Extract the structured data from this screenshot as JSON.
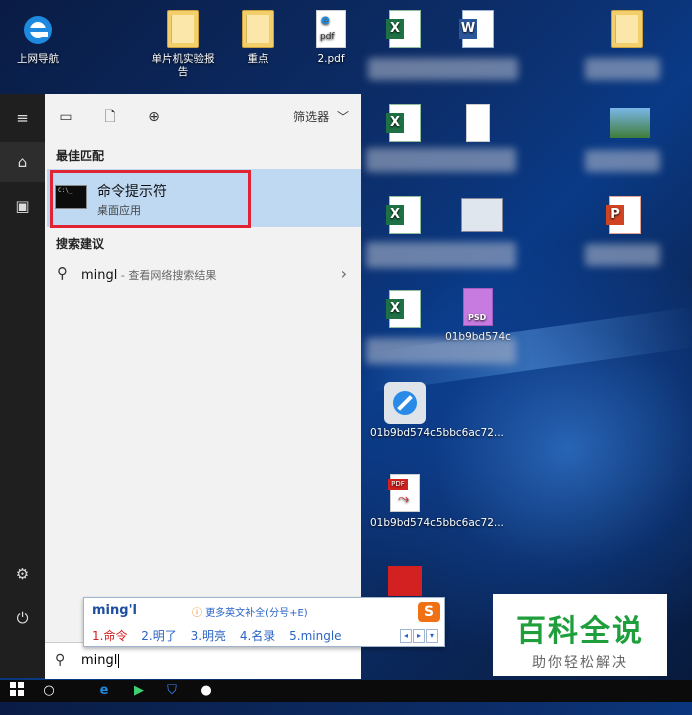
{
  "desktop": {
    "icons": [
      {
        "label": "上网导航",
        "kind": "ie"
      },
      {
        "label": "单片机实验报告",
        "kind": "folder"
      },
      {
        "label": "重点",
        "kind": "folder"
      },
      {
        "label": "2.pdf",
        "kind": "pdf"
      },
      {
        "label": "01b9bd574c5bbc6ac72...",
        "kind": "safari"
      },
      {
        "label": "01b9bd574c5bbc6ac72...",
        "kind": "pdf-red"
      },
      {
        "label": "01b9bd574c",
        "kind": "psd"
      }
    ]
  },
  "start_menu": {
    "rail": {
      "menu": "≡",
      "home": "⌂",
      "docs": "▣",
      "settings": "⚙",
      "power": "⏻"
    },
    "filter_label": "筛选器",
    "best_match_heading": "最佳匹配",
    "best_match": {
      "title": "命令提示符",
      "subtitle": "桌面应用"
    },
    "suggestions_heading": "搜索建议",
    "suggestion": {
      "query": "mingl",
      "desc": " - 查看网络搜索结果"
    },
    "search_value": "mingl"
  },
  "ime": {
    "composition": "ming'l",
    "hint": "更多英文补全(分号+E)",
    "candidates": [
      "1.命令",
      "2.明了",
      "3.明亮",
      "4.名录",
      "5.mingle"
    ],
    "logo": "S"
  },
  "watermark": {
    "title": "百科全说",
    "subtitle": "助你轻松解决"
  },
  "colors": {
    "highlight_box": "#e02433",
    "selection": "#bfd9f2",
    "brand_green": "#1f9e3c"
  }
}
